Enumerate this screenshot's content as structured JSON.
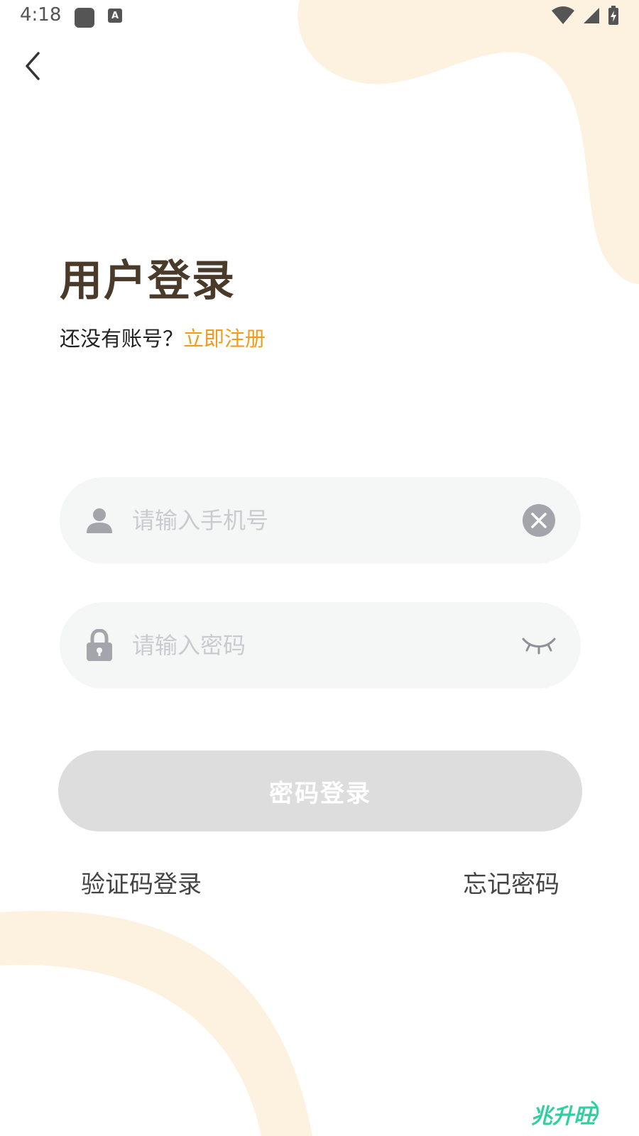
{
  "status_bar": {
    "time": "4:18"
  },
  "header": {
    "back_icon": "chevron-left-icon"
  },
  "title": "用户登录",
  "register": {
    "prompt": "还没有账号？",
    "link": "立即注册"
  },
  "phone_field": {
    "icon": "person-icon",
    "placeholder": "请输入手机号",
    "value": "",
    "clear_icon": "clear-circle-icon"
  },
  "password_field": {
    "icon": "lock-icon",
    "placeholder": "请输入密码",
    "value": "",
    "toggle_icon": "eye-closed-icon"
  },
  "login_button": "密码登录",
  "sms_login": "验证码登录",
  "forgot_password": "忘记密码",
  "watermark": "兆升旺",
  "colors": {
    "accent": "#f29b1f",
    "title": "#4a3a2a",
    "field_bg": "#f5f7f7",
    "button_disabled": "#dddddd",
    "decor": "#fdf2df",
    "watermark": "#2fd0a0"
  }
}
